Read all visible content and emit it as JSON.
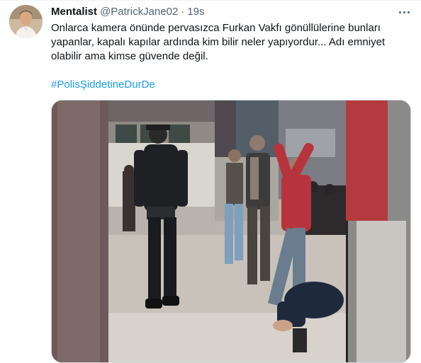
{
  "tweet": {
    "display_name": "Mentalist",
    "handle": "@PatrickJane02",
    "separator": "·",
    "time": "19s",
    "text": "Onlarca kamera önünde pervasızca Furkan Vakfı gönüllülerine bunları yapanlar, kapalı kapılar ardında kim bilir neler yapıyordur... Adı emniyet olabilir ama kimse güvende değil.",
    "hashtag": "#PolisŞiddetineDurDe"
  },
  "colors": {
    "link": "#1d9bf0",
    "text": "#0f1419",
    "secondary": "#536471"
  },
  "icons": {
    "more": "more-horizontal-icon"
  }
}
